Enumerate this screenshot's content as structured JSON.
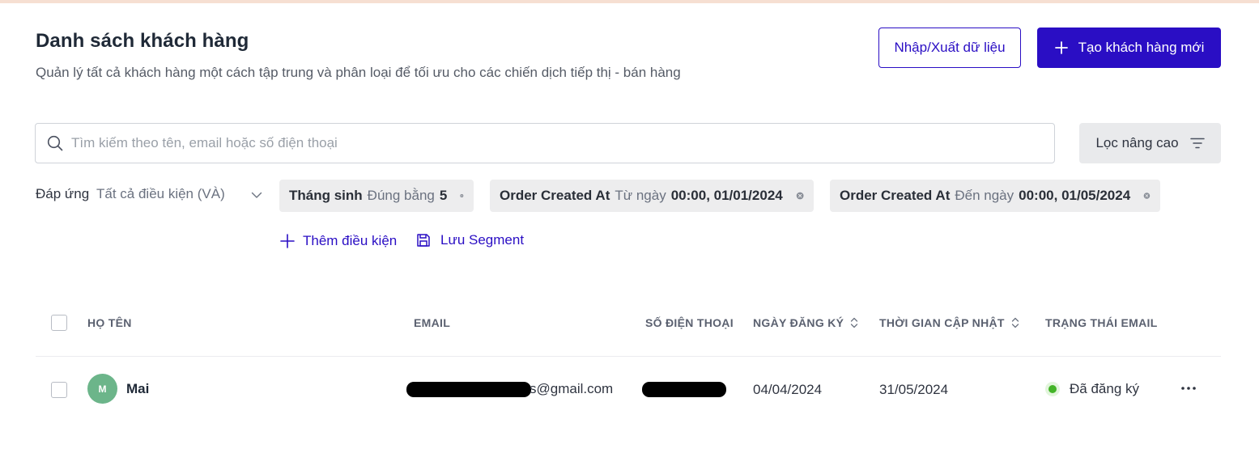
{
  "header": {
    "title": "Danh sách khách hàng",
    "subtitle": "Quản lý tất cả khách hàng một cách tập trung và phân loại để tối ưu cho các chiến dịch tiếp thị - bán hàng",
    "import_export_label": "Nhập/Xuất dữ liệu",
    "create_label": "Tạo khách hàng mới"
  },
  "search": {
    "placeholder": "Tìm kiếm theo tên, email hoặc số điện thoại",
    "value": ""
  },
  "filter_button_label": "Lọc nâng cao",
  "conditions": {
    "match_label": "Đáp ứng",
    "match_value": "Tất cả điều kiện (VÀ)",
    "chips": [
      {
        "field": "Tháng sinh",
        "operator": "Đúng bằng",
        "value": "5"
      },
      {
        "field": "Order Created At",
        "operator": "Từ ngày",
        "value": "00:00, 01/01/2024"
      },
      {
        "field": "Order Created At",
        "operator": "Đến ngày",
        "value": "00:00, 01/05/2024"
      }
    ],
    "add_condition_label": "Thêm điều kiện",
    "save_segment_label": "Lưu Segment"
  },
  "table": {
    "columns": {
      "name": "HỌ TÊN",
      "email": "EMAIL",
      "phone": "SỐ ĐIỆN THOẠI",
      "registered": "NGÀY ĐĂNG KÝ",
      "updated": "THỜI GIAN CẬP NHẬT",
      "email_status": "TRẠNG THÁI EMAIL"
    },
    "rows": [
      {
        "avatar_initial": "M",
        "name": "Mai",
        "email_visible_suffix": "s@gmail.com",
        "registered": "04/04/2024",
        "updated": "31/05/2024",
        "email_status": "Đã đăng ký"
      }
    ]
  },
  "icons": {
    "create": "plus-icon",
    "search": "search-icon",
    "filter": "filter-lines-icon",
    "match_dropdown": "chevron-down-icon",
    "chip_remove": "close-circle-icon",
    "add_condition": "plus-icon",
    "save_segment": "save-icon",
    "sort": "sort-icon",
    "row_menu": "more-horizontal-icon"
  },
  "colors": {
    "primary": "#2a0ec4",
    "status_green": "#43b427",
    "avatar": "#6cb58a"
  }
}
